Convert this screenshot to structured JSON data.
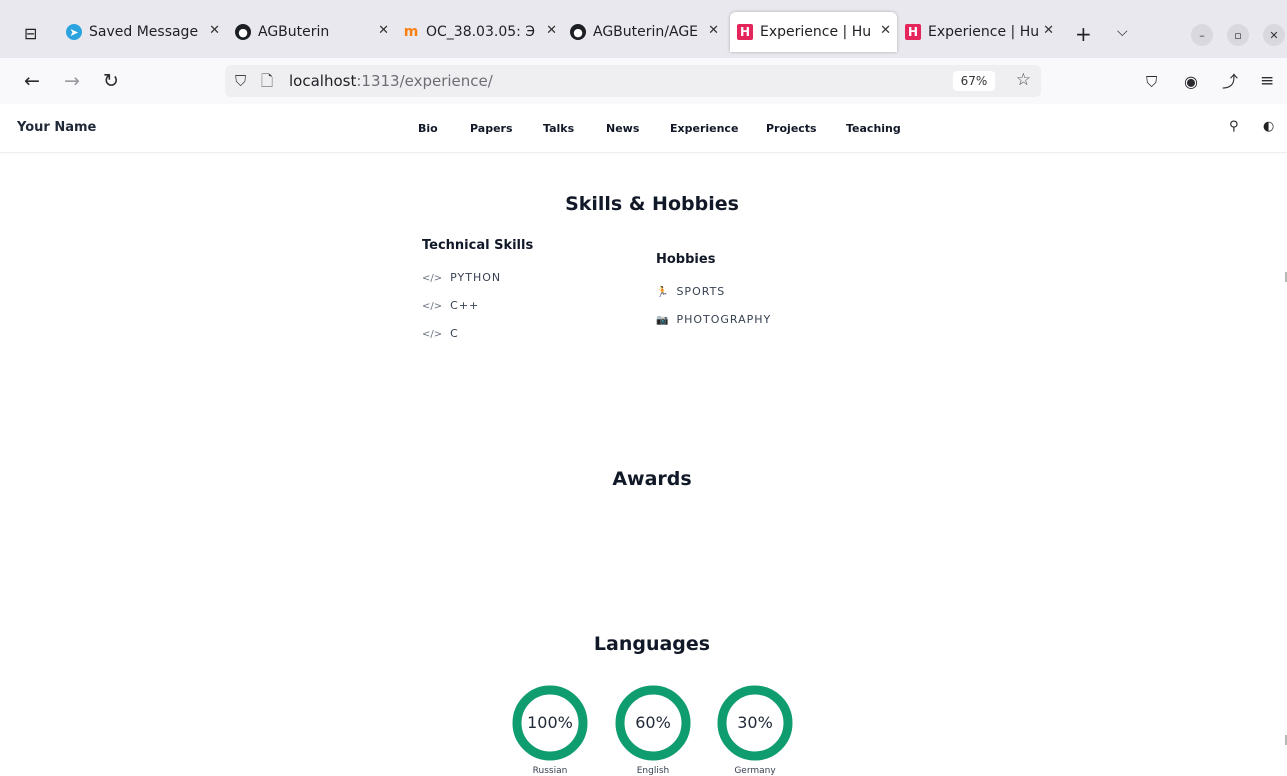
{
  "browser": {
    "tabs": [
      {
        "label": "Saved Message",
        "favicon": "telegram-icon"
      },
      {
        "label": "AGButerin",
        "favicon": "github-icon"
      },
      {
        "label": "OC_38.03.05: Э",
        "favicon": "moodle-icon"
      },
      {
        "label": "AGButerin/AGE",
        "favicon": "github-icon"
      },
      {
        "label": "Experience | Hu",
        "favicon": "hugo-icon",
        "active": true
      },
      {
        "label": "Experience | Hu",
        "favicon": "hugo-icon"
      }
    ],
    "url_host": "localhost",
    "url_rest": ":1313/experience/",
    "zoom": "67%"
  },
  "site": {
    "brand": "Your Name",
    "menu": [
      "Bio",
      "Papers",
      "Talks",
      "News",
      "Experience",
      "Projects",
      "Teaching"
    ]
  },
  "skills": {
    "title": "Skills & Hobbies",
    "technical": {
      "title": "Technical Skills",
      "items": [
        "PYTHON",
        "C++",
        "C"
      ]
    },
    "hobbies": {
      "title": "Hobbies",
      "items": [
        "SPORTS",
        "PHOTOGRAPHY"
      ]
    }
  },
  "awards": {
    "title": "Awards"
  },
  "languages": {
    "title": "Languages",
    "accent": "#0f9d70",
    "items": [
      {
        "name": "Russian",
        "percent": 100,
        "label": "100%"
      },
      {
        "name": "English",
        "percent": 60,
        "label": "60%"
      },
      {
        "name": "Germany",
        "percent": 30,
        "label": "30%"
      }
    ]
  }
}
